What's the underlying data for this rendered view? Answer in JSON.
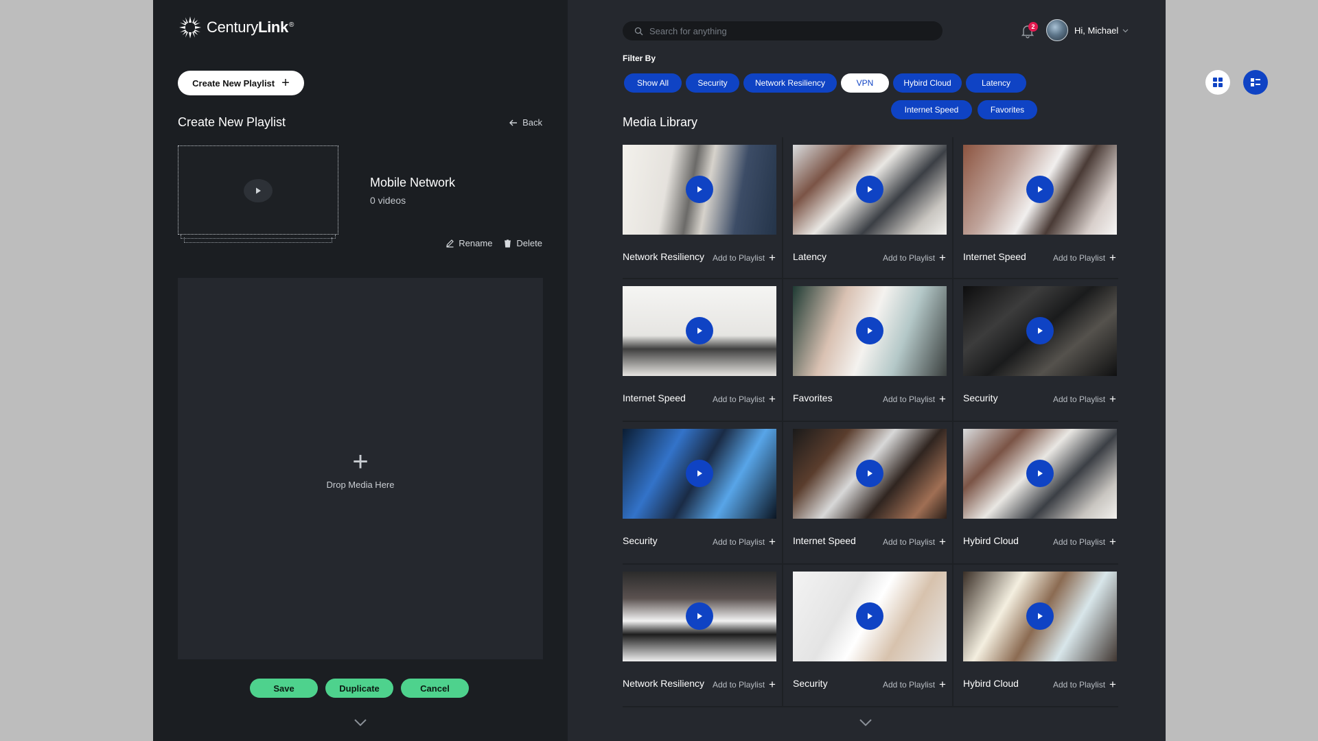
{
  "brand": {
    "name_light": "Century",
    "name_bold": "Link",
    "reg": "®"
  },
  "left": {
    "create_button": "Create New Playlist",
    "section_title": "Create New Playlist",
    "back_label": "Back",
    "playlist": {
      "name": "Mobile Network",
      "count": "0 videos"
    },
    "rename_label": "Rename",
    "delete_label": "Delete",
    "drop_label": "Drop Media Here",
    "save_label": "Save",
    "duplicate_label": "Duplicate",
    "cancel_label": "Cancel"
  },
  "header": {
    "search_placeholder": "Search for anything",
    "notifications_count": "2",
    "greeting": "Hi, Michael"
  },
  "filters": {
    "label": "Filter By",
    "items": [
      {
        "label": "Show All",
        "active": false
      },
      {
        "label": "Security",
        "active": false
      },
      {
        "label": "Network Resiliency",
        "active": false
      },
      {
        "label": "VPN",
        "active": true
      },
      {
        "label": "Hybird Cloud",
        "active": false
      },
      {
        "label": "Latency",
        "active": false
      },
      {
        "label": "Internet Speed",
        "active": false
      },
      {
        "label": "Favorites",
        "active": false
      }
    ]
  },
  "library": {
    "title": "Media Library",
    "add_label": "Add to Playlist",
    "items": [
      {
        "title": "Network Resiliency"
      },
      {
        "title": "Latency"
      },
      {
        "title": "Internet Speed"
      },
      {
        "title": "Internet Speed"
      },
      {
        "title": "Favorites"
      },
      {
        "title": "Security"
      },
      {
        "title": "Security"
      },
      {
        "title": "Internet Speed"
      },
      {
        "title": "Hybird Cloud"
      },
      {
        "title": "Network Resiliency"
      },
      {
        "title": "Security"
      },
      {
        "title": "Hybird Cloud"
      }
    ]
  },
  "colors": {
    "accent_blue": "#0f43c4",
    "green": "#4ed28d",
    "badge_red": "#e3194f"
  }
}
